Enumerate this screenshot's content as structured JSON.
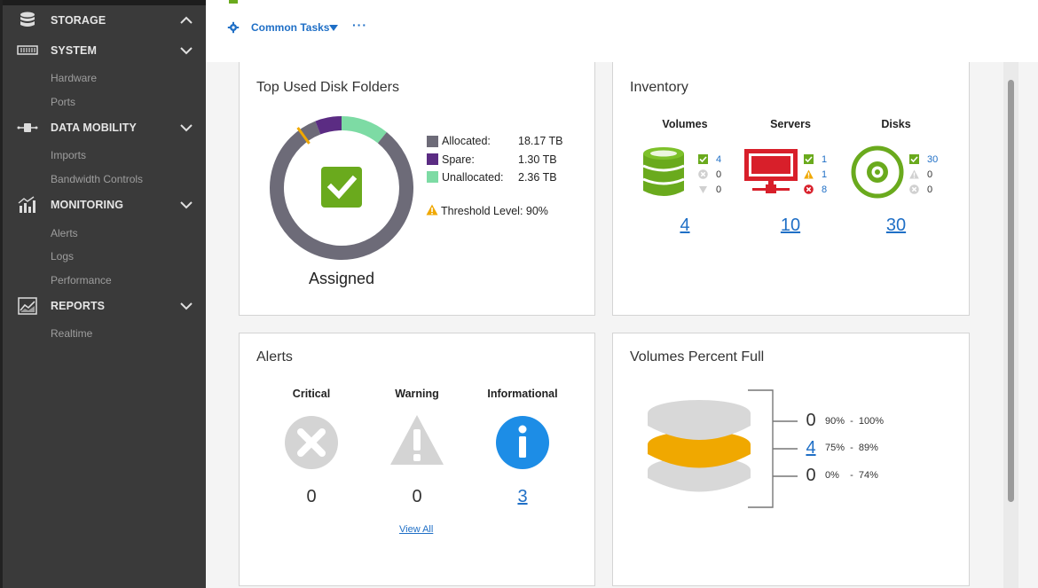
{
  "sidebar": {
    "sections": [
      {
        "label": "STORAGE",
        "icon": "database-icon",
        "state": "expanded"
      },
      {
        "label": "SYSTEM",
        "icon": "server-rack-icon",
        "state": "collapsed",
        "items": [
          "Hardware",
          "Ports"
        ]
      },
      {
        "label": "DATA MOBILITY",
        "icon": "data-transfer-icon",
        "state": "collapsed",
        "items": [
          "Imports",
          "Bandwidth Controls"
        ]
      },
      {
        "label": "MONITORING",
        "icon": "bar-chart-icon",
        "state": "collapsed",
        "items": [
          "Alerts",
          "Logs",
          "Performance"
        ]
      },
      {
        "label": "REPORTS",
        "icon": "line-chart-icon",
        "state": "collapsed",
        "items": [
          "Realtime"
        ]
      }
    ]
  },
  "toolbar": {
    "common_tasks_label": "Common Tasks",
    "more_label": "···"
  },
  "disk_folders": {
    "title": "Top Used Disk Folders",
    "center_label": "Assigned",
    "legend": [
      {
        "label": "Allocated:",
        "value": "18.17 TB",
        "color": "#6d6b78"
      },
      {
        "label": "Spare:",
        "value": "1.30 TB",
        "color": "#5b2c83"
      },
      {
        "label": "Unallocated:",
        "value": "2.36 TB",
        "color": "#7ddba4"
      }
    ],
    "threshold_label": "Threshold Level: 90%",
    "donut": {
      "allocated": 18.17,
      "spare": 1.3,
      "unallocated": 2.36,
      "threshold_pct": 90
    }
  },
  "inventory": {
    "title": "Inventory",
    "columns": [
      {
        "title": "Volumes",
        "count": "4",
        "stats": [
          {
            "icon": "check-icon",
            "value": "4"
          },
          {
            "icon": "circle-x-icon",
            "value": "0"
          },
          {
            "icon": "down-triangle-icon",
            "value": "0"
          }
        ]
      },
      {
        "title": "Servers",
        "count": "10",
        "stats": [
          {
            "icon": "check-icon",
            "value": "1"
          },
          {
            "icon": "warning-icon",
            "value": "1"
          },
          {
            "icon": "error-icon",
            "value": "8"
          }
        ]
      },
      {
        "title": "Disks",
        "count": "30",
        "stats": [
          {
            "icon": "check-icon",
            "value": "30"
          },
          {
            "icon": "warning-icon",
            "value": "0"
          },
          {
            "icon": "circle-x-icon",
            "value": "0"
          }
        ]
      }
    ]
  },
  "alerts": {
    "title": "Alerts",
    "columns": [
      {
        "title": "Critical",
        "count": "0"
      },
      {
        "title": "Warning",
        "count": "0"
      },
      {
        "title": "Informational",
        "count": "3"
      }
    ],
    "view_all_label": "View All"
  },
  "volumes_full": {
    "title": "Volumes Percent Full",
    "rows": [
      {
        "count": "0",
        "range": "90%  -  100%"
      },
      {
        "count": "4",
        "range": "75%  -  89%"
      },
      {
        "count": "0",
        "range": "0%    -  74%"
      }
    ]
  },
  "colors": {
    "sidebar_bg": "#3a3a3a",
    "accent_blue": "#1f6fc6",
    "green": "#6aaa1d",
    "red": "#d81f2a",
    "orange": "#f0a800",
    "info_blue": "#1d8de6"
  }
}
